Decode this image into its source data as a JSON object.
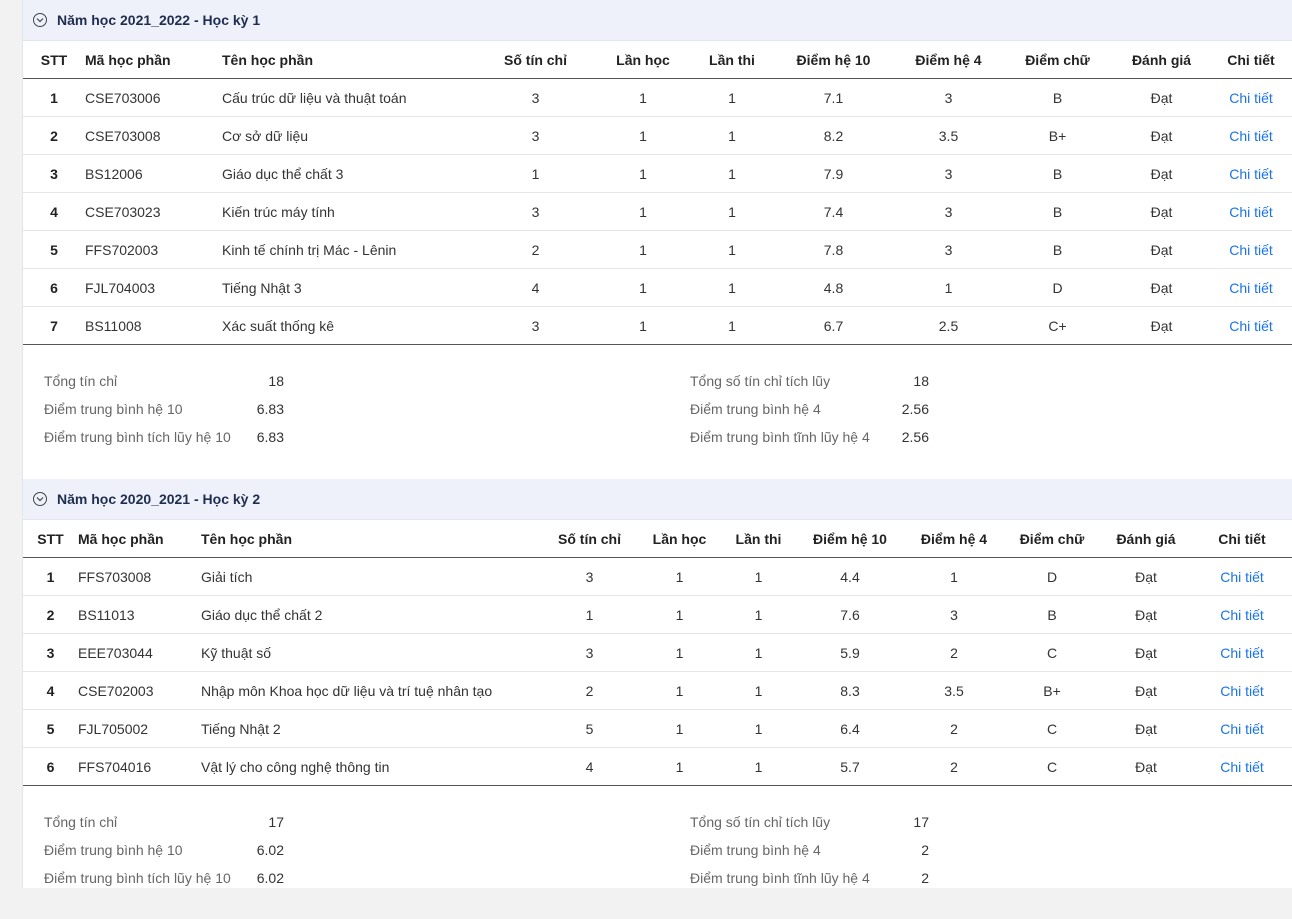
{
  "semesters": [
    {
      "title": "Năm học 2021_2022 - Học kỳ 1",
      "headers": [
        "STT",
        "Mã học phần",
        "Tên học phần",
        "Số tín chỉ",
        "Lần học",
        "Lần thi",
        "Điểm hệ 10",
        "Điểm hệ 4",
        "Điểm chữ",
        "Đánh giá",
        "Chi tiết"
      ],
      "rows": [
        [
          "1",
          "CSE703006",
          "Cấu trúc dữ liệu và thuật toán",
          "3",
          "1",
          "1",
          "7.1",
          "3",
          "B",
          "Đạt",
          "Chi tiết"
        ],
        [
          "2",
          "CSE703008",
          "Cơ sở dữ liệu",
          "3",
          "1",
          "1",
          "8.2",
          "3.5",
          "B+",
          "Đạt",
          "Chi tiết"
        ],
        [
          "3",
          "BS12006",
          "Giáo dục thể chất 3",
          "1",
          "1",
          "1",
          "7.9",
          "3",
          "B",
          "Đạt",
          "Chi tiết"
        ],
        [
          "4",
          "CSE703023",
          "Kiến trúc máy tính",
          "3",
          "1",
          "1",
          "7.4",
          "3",
          "B",
          "Đạt",
          "Chi tiết"
        ],
        [
          "5",
          "FFS702003",
          "Kinh tế chính trị Mác - Lênin",
          "2",
          "1",
          "1",
          "7.8",
          "3",
          "B",
          "Đạt",
          "Chi tiết"
        ],
        [
          "6",
          "FJL704003",
          "Tiếng Nhật 3",
          "4",
          "1",
          "1",
          "4.8",
          "1",
          "D",
          "Đạt",
          "Chi tiết"
        ],
        [
          "7",
          "BS11008",
          "Xác suất thống kê",
          "3",
          "1",
          "1",
          "6.7",
          "2.5",
          "C+",
          "Đạt",
          "Chi tiết"
        ]
      ],
      "summary": {
        "left": [
          {
            "label": "Tổng tín chỉ",
            "value": "18"
          },
          {
            "label": "Điểm trung bình hệ 10",
            "value": "6.83"
          },
          {
            "label": "Điểm trung bình tích lũy hệ 10",
            "value": "6.83"
          }
        ],
        "right": [
          {
            "label": "Tổng số tín chỉ tích lũy",
            "value": "18"
          },
          {
            "label": "Điểm trung bình hệ 4",
            "value": "2.56"
          },
          {
            "label": "Điểm trung bình tĩnh lũy hệ 4",
            "value": "2.56"
          }
        ]
      }
    },
    {
      "title": "Năm học 2020_2021 - Học kỳ 2",
      "headers": [
        "STT",
        "Mã học phần",
        "Tên học phần",
        "Số tín chỉ",
        "Lần học",
        "Lần thi",
        "Điểm hệ 10",
        "Điểm hệ 4",
        "Điểm chữ",
        "Đánh giá",
        "Chi tiết"
      ],
      "rows": [
        [
          "1",
          "FFS703008",
          "Giải tích",
          "3",
          "1",
          "1",
          "4.4",
          "1",
          "D",
          "Đạt",
          "Chi tiết"
        ],
        [
          "2",
          "BS11013",
          "Giáo dục thể chất 2",
          "1",
          "1",
          "1",
          "7.6",
          "3",
          "B",
          "Đạt",
          "Chi tiết"
        ],
        [
          "3",
          "EEE703044",
          "Kỹ thuật số",
          "3",
          "1",
          "1",
          "5.9",
          "2",
          "C",
          "Đạt",
          "Chi tiết"
        ],
        [
          "4",
          "CSE702003",
          "Nhập môn Khoa học dữ liệu và trí tuệ nhân tạo",
          "2",
          "1",
          "1",
          "8.3",
          "3.5",
          "B+",
          "Đạt",
          "Chi tiết"
        ],
        [
          "5",
          "FJL705002",
          "Tiếng Nhật 2",
          "5",
          "1",
          "1",
          "6.4",
          "2",
          "C",
          "Đạt",
          "Chi tiết"
        ],
        [
          "6",
          "FFS704016",
          "Vật lý cho công nghệ thông tin",
          "4",
          "1",
          "1",
          "5.7",
          "2",
          "C",
          "Đạt",
          "Chi tiết"
        ]
      ],
      "summary": {
        "left": [
          {
            "label": "Tổng tín chỉ",
            "value": "17"
          },
          {
            "label": "Điểm trung bình hệ 10",
            "value": "6.02"
          },
          {
            "label": "Điểm trung bình tích lũy hệ 10",
            "value": "6.02"
          }
        ],
        "right": [
          {
            "label": "Tổng số tín chỉ tích lũy",
            "value": "17"
          },
          {
            "label": "Điểm trung bình hệ 4",
            "value": "2"
          },
          {
            "label": "Điểm trung bình tĩnh lũy hệ 4",
            "value": "2"
          }
        ]
      }
    }
  ],
  "icons": {
    "toggle": "chevron-down-circle-icon"
  },
  "colors": {
    "header_bg": "#eef1fa",
    "link": "#1a73e8",
    "title": "#1f2d4f"
  }
}
